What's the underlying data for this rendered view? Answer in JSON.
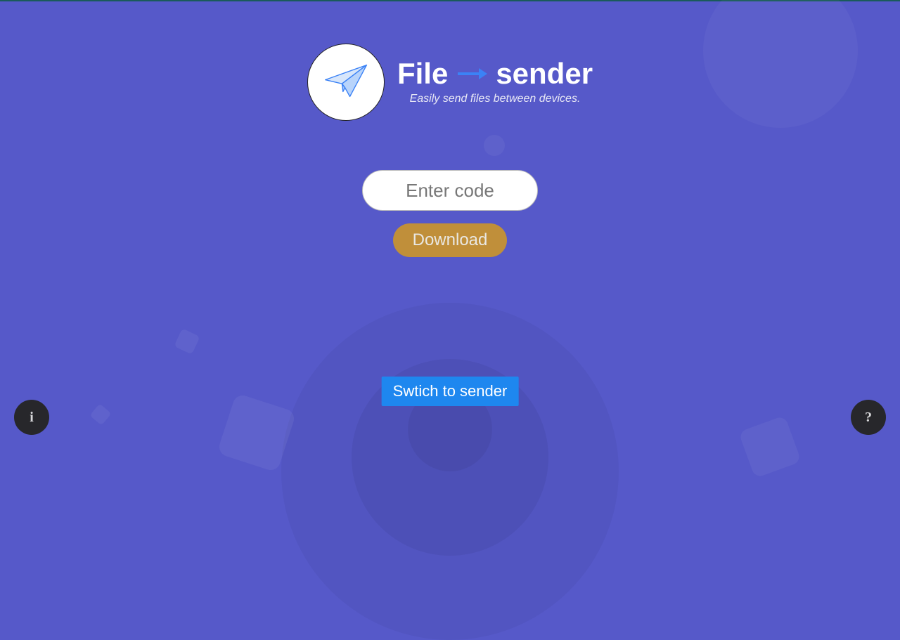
{
  "logo": {
    "word1": "File",
    "word2": "sender"
  },
  "tagline": "Easily send files between devices.",
  "form": {
    "code_placeholder": "Enter code",
    "download_label": "Download"
  },
  "switch_label": "Swtich to sender",
  "fab": {
    "info": "i",
    "help": "?"
  }
}
